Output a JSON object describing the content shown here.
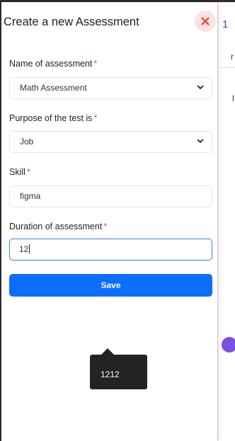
{
  "dialog": {
    "title": "Create a new Assessment",
    "close_icon": "close-x-icon",
    "accent_close": "#e2452e",
    "close_bg": "#fbe3e0"
  },
  "form": {
    "name_label": "Name of assessment",
    "name_value": "Math Assessment",
    "purpose_label": "Purpose of the test is",
    "purpose_value": "Job",
    "skill_label": "Skill",
    "skill_value": "figma",
    "duration_label": "Duration of assessment",
    "duration_value": "12",
    "required_mark": "*",
    "chevron_icon": "chevron-down-icon"
  },
  "actions": {
    "save_label": "Save",
    "save_color": "#0d6efd"
  },
  "tooltip": {
    "text": "1212"
  },
  "background": {
    "glyph_1": "1",
    "glyph_2": "r",
    "glyph_3": "l"
  }
}
